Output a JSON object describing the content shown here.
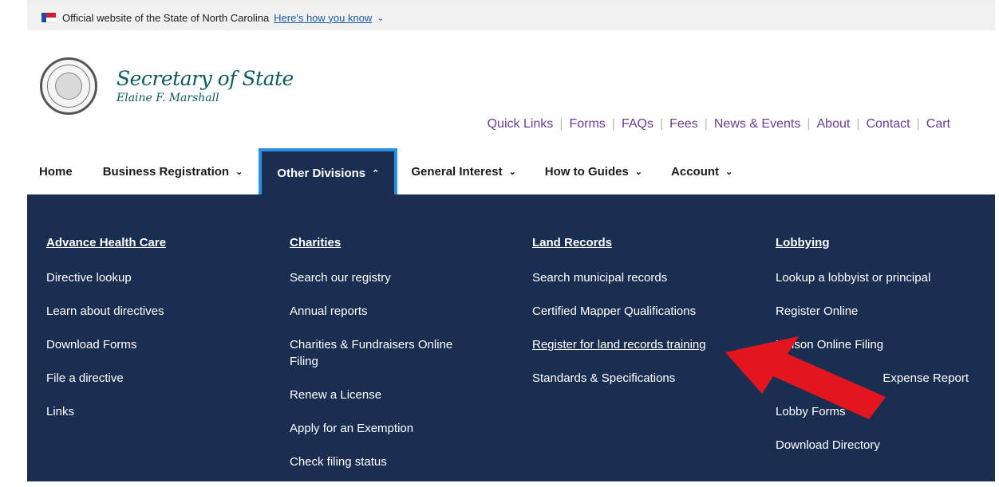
{
  "gov_banner": {
    "text": "Official website of the State of North Carolina",
    "link": "Here's how you know"
  },
  "brand": {
    "title": "Secretary of State",
    "subtitle": "Elaine F. Marshall"
  },
  "utility_links": [
    "Quick Links",
    "Forms",
    "FAQs",
    "Fees",
    "News & Events",
    "About",
    "Contact",
    "Cart"
  ],
  "main_nav": {
    "home": "Home",
    "business": "Business Registration",
    "other": "Other Divisions",
    "general": "General Interest",
    "howto": "How to Guides",
    "account": "Account"
  },
  "mega_menu": {
    "col1": {
      "heading": "Advance Health Care",
      "links": [
        "Directive lookup",
        "Learn about directives",
        "Download Forms",
        "File a directive",
        "Links"
      ]
    },
    "col2": {
      "heading": "Charities",
      "links": [
        "Search our registry",
        "Annual reports",
        "Charities & Fundraisers Online Filing",
        "Renew a License",
        "Apply for an Exemption",
        "Check filing status"
      ]
    },
    "col3": {
      "heading": "Land Records",
      "links": [
        "Search municipal records",
        "Certified Mapper Qualifications",
        "Register for land records training",
        "Standards & Specifications"
      ]
    },
    "col4": {
      "heading": "Lobbying",
      "links": [
        "Lookup a lobbyist or principal",
        "Register Online",
        "Liaison Online Filing",
        "Expense Report",
        "Lobby Forms",
        "Download Directory"
      ]
    }
  },
  "colors": {
    "panel": "#1a2e52",
    "active_border": "#2b8fe4",
    "utility_link": "#6a3c93",
    "brand": "#0f5c5c",
    "annotation_arrow": "#e3151e"
  }
}
